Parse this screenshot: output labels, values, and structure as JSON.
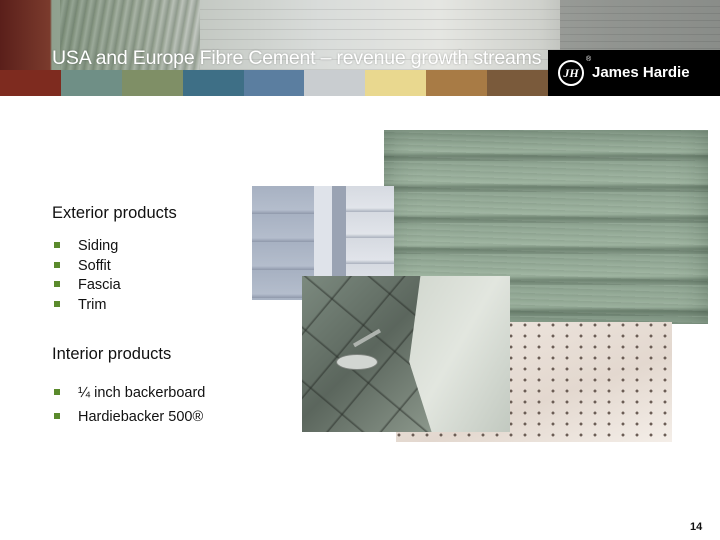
{
  "header": {
    "title": "USA and Europe Fibre Cement – revenue growth streams",
    "logo_text": "James Hardie",
    "logo_mark": "JH",
    "logo_reg": "®",
    "swatch_colors": [
      "#7e2b1f",
      "#6f8f86",
      "#7f8f66",
      "#3e6f86",
      "#5b7ea0",
      "#c9cdd0",
      "#e9d88f",
      "#a87b45",
      "#7a5a3b"
    ]
  },
  "exterior": {
    "title": "Exterior products",
    "items": [
      "Siding",
      "Soffit",
      "Fascia",
      "Trim"
    ]
  },
  "interior": {
    "title": "Interior products",
    "items": [
      "¼ inch backerboard",
      "Hardiebacker 500®"
    ]
  },
  "colors": {
    "bullet": "#5a8a2c"
  },
  "page_number": "14"
}
